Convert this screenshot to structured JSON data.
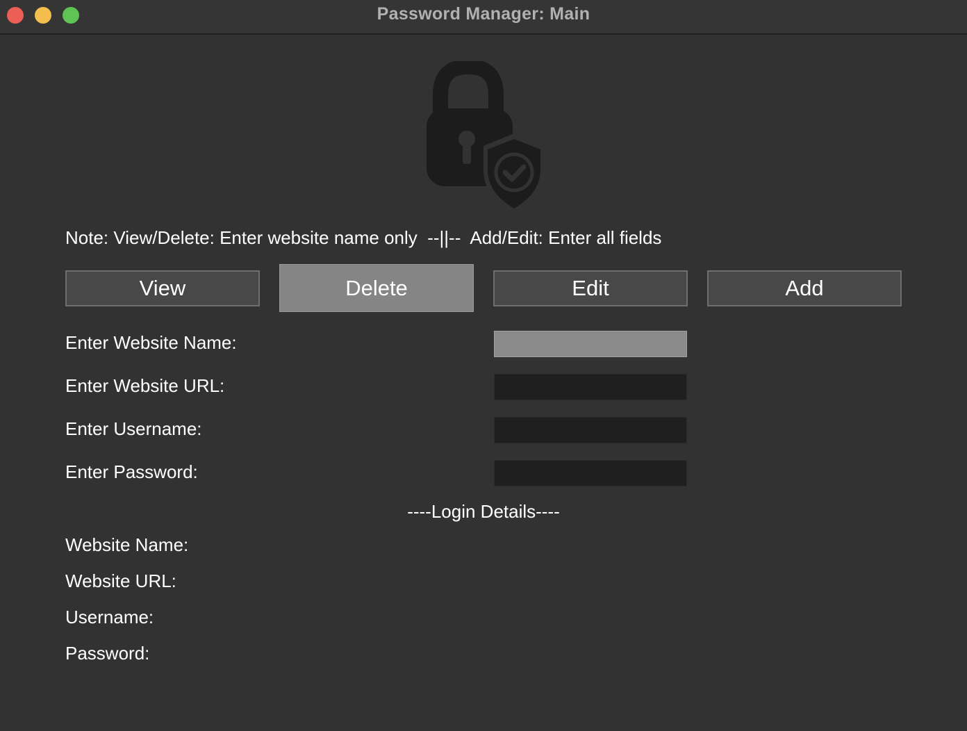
{
  "window": {
    "title": "Password Manager: Main"
  },
  "logo": {
    "icon": "lock-shield-icon"
  },
  "note": "Note: View/Delete: Enter website name only  --||--  Add/Edit: Enter all fields",
  "actions": {
    "view": "View",
    "delete": "Delete",
    "edit": "Edit",
    "add": "Add",
    "active": "delete"
  },
  "form": {
    "website_name_label": "Enter Website Name:",
    "website_url_label": "Enter Website URL:",
    "username_label": "Enter Username:",
    "password_label": "Enter Password:",
    "website_name_value": "",
    "website_url_value": "",
    "username_value": "",
    "password_value": ""
  },
  "details": {
    "heading": "----Login Details----",
    "website_name_label": "Website Name:",
    "website_url_label": "Website URL:",
    "username_label": "Username:",
    "password_label": "Password:"
  },
  "colors": {
    "background": "#323232",
    "button": "#484848",
    "button_active": "#858585",
    "input": "#1f1f1f",
    "input_focused": "#8a8a8a",
    "logo": "#1c1c1c"
  }
}
